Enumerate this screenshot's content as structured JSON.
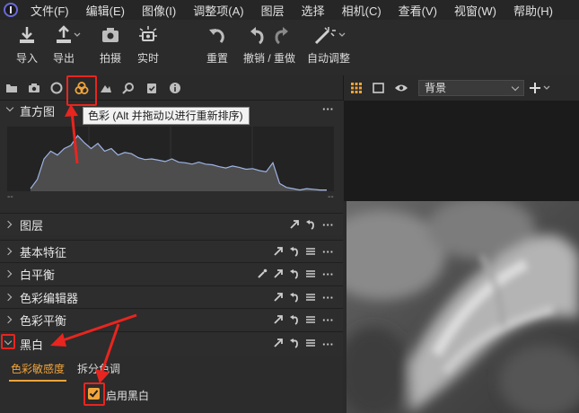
{
  "menu": [
    "文件(F)",
    "编辑(E)",
    "图像(I)",
    "调整项(A)",
    "图层",
    "选择",
    "相机(C)",
    "查看(V)",
    "视窗(W)",
    "帮助(H)"
  ],
  "toolbar": {
    "import": "导入",
    "export": "导出",
    "capture": "拍摄",
    "live": "实时",
    "reset": "重置",
    "undo_redo": "撤销 / 重做",
    "auto_adjust": "自动调整"
  },
  "tool_tabs": [
    "folder-icon",
    "camera-icon",
    "lens-icon",
    "color-icon",
    "exposure-icon",
    "search-icon",
    "clipboard-icon",
    "info-icon"
  ],
  "tooltip": "色彩 (Alt 并拖动以进行重新排序)",
  "histogram": {
    "title": "直方图",
    "left_dash": "--",
    "right_dash": "--",
    "levels": [
      0.04,
      0.18,
      0.5,
      0.62,
      0.56,
      0.66,
      0.71,
      0.86,
      0.75,
      0.66,
      0.74,
      0.62,
      0.66,
      0.56,
      0.6,
      0.58,
      0.52,
      0.49,
      0.5,
      0.48,
      0.46,
      0.5,
      0.45,
      0.44,
      0.42,
      0.45,
      0.42,
      0.41,
      0.38,
      0.36,
      0.39,
      0.37,
      0.34,
      0.35,
      0.32,
      0.3,
      0.44,
      0.12,
      0.06,
      0.04,
      0.02,
      0.04,
      0.03,
      0.02,
      0.02
    ]
  },
  "sections": [
    {
      "id": "layers",
      "label": "图层"
    },
    {
      "id": "basic",
      "label": "基本特征"
    },
    {
      "id": "wb",
      "label": "白平衡"
    },
    {
      "id": "color-editor",
      "label": "色彩编辑器"
    },
    {
      "id": "color-balance",
      "label": "色彩平衡"
    },
    {
      "id": "bw",
      "label": "黑白"
    }
  ],
  "bw_tabs": {
    "sensitivity": "色彩敏感度",
    "split": "拆分色调"
  },
  "enable_bw": {
    "label": "启用黑白",
    "checked": true
  },
  "viewer": {
    "layer_select": "背景"
  },
  "colors": {
    "accent": "#f2a43a",
    "highlight": "#e8251f"
  }
}
